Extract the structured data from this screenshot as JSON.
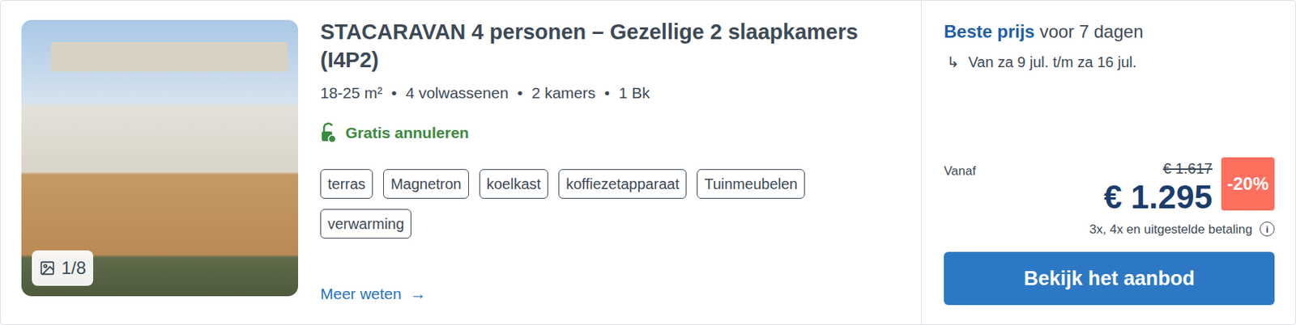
{
  "photo": {
    "counter": "1/8"
  },
  "title": "STACARAVAN 4 personen – Gezellige 2 slaapkamers (I4P2)",
  "specs": [
    {
      "text": "18-25 m²"
    },
    {
      "text": "4 volwassenen"
    },
    {
      "text": "2 kamers"
    },
    {
      "text": "1 Bk"
    }
  ],
  "spec_separator": "•",
  "cancellation": "Gratis annuleren",
  "amenities": [
    "terras",
    "Magnetron",
    "koelkast",
    "koffiezetapparaat",
    "Tuinmeubelen",
    "verwarming"
  ],
  "more_link": {
    "label": "Meer weten",
    "arrow": "→"
  },
  "price": {
    "heading_strong": "Beste prijs",
    "heading_rest": "voor 7 dagen",
    "arrow": "↳",
    "dates": "Van za 9 jul. t/m za 16 jul.",
    "from": "Vanaf",
    "old": "€ 1.617",
    "current": "€ 1.295",
    "discount": "-20%",
    "payment": "3x, 4x en uitgestelde betaling",
    "info": "i"
  },
  "button": "Bekijk het aanbod"
}
